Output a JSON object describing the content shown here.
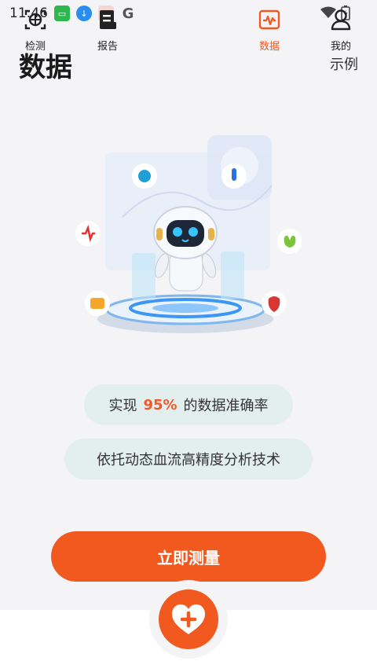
{
  "status_bar": {
    "time": "11:46"
  },
  "header": {
    "title": "数据",
    "example": "示例"
  },
  "pills": {
    "accuracy_prefix": "实现",
    "accuracy_value": "95%",
    "accuracy_suffix": "的数据准确率",
    "technology": "依托动态血流高精度分析技术"
  },
  "cta": {
    "label": "立即测量"
  },
  "tabbar": {
    "items": [
      {
        "label": "检测",
        "icon": "scan-icon"
      },
      {
        "label": "报告",
        "icon": "report-icon"
      },
      {
        "label": "",
        "icon": "heart-plus-icon"
      },
      {
        "label": "数据",
        "icon": "pulse-chart-icon"
      },
      {
        "label": "我的",
        "icon": "profile-icon"
      }
    ]
  },
  "colors": {
    "accent": "#f2591f",
    "pill_bg": "#e2efee",
    "background": "#f4f4f7"
  }
}
